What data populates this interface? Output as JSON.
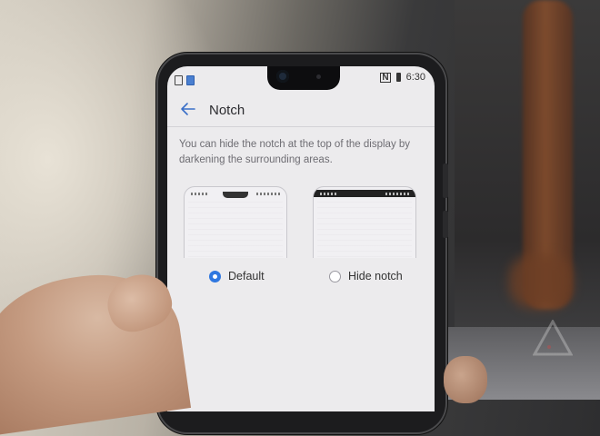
{
  "status_bar": {
    "time": "6:30",
    "nfc_label": "N"
  },
  "header": {
    "title": "Notch"
  },
  "description": "You can hide the notch at the top of the display by darkening the surrounding areas.",
  "options": [
    {
      "label": "Default",
      "selected": true
    },
    {
      "label": "Hide notch",
      "selected": false
    }
  ],
  "colors": {
    "accent": "#2f77e0"
  }
}
